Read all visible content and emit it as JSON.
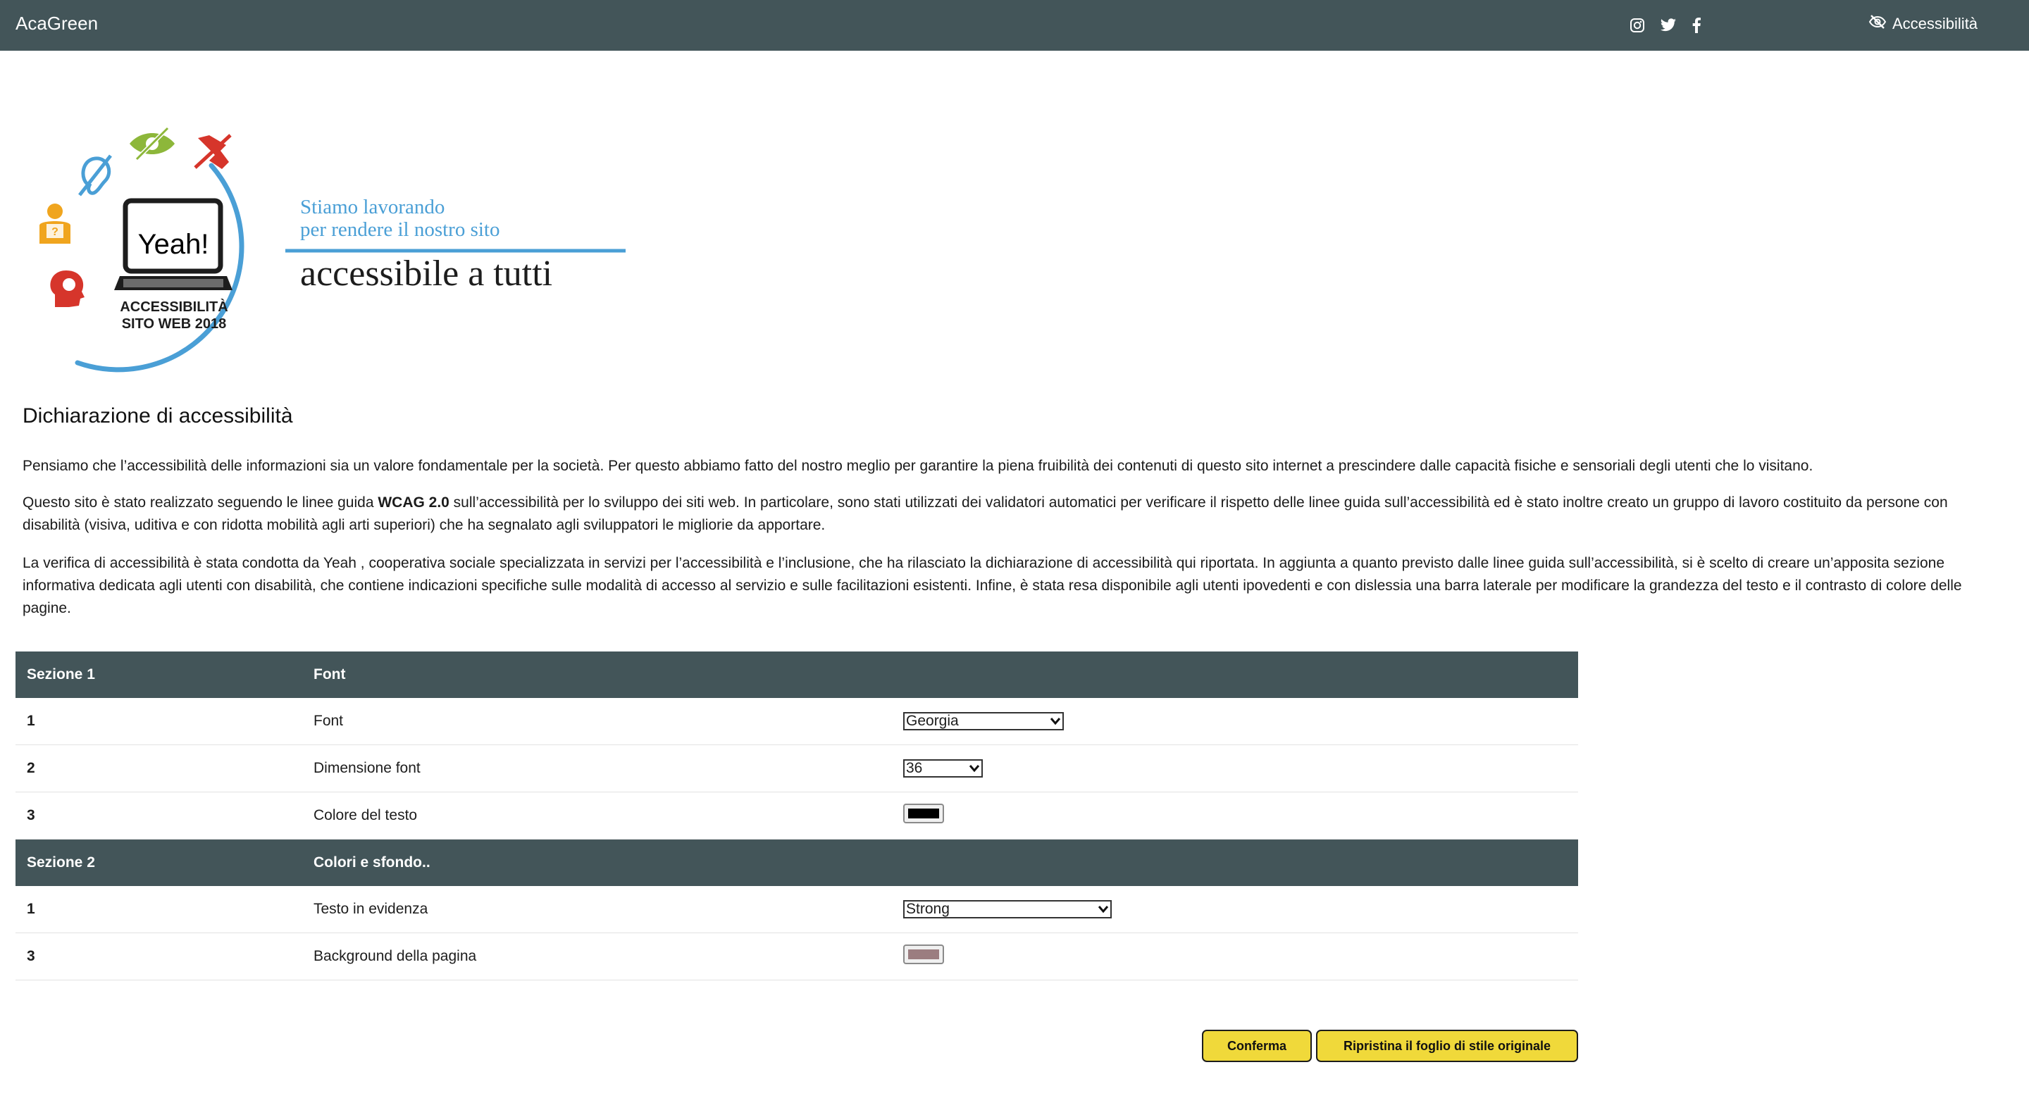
{
  "navbar": {
    "brand": "AcaGreen",
    "social": [
      "instagram-icon",
      "twitter-icon",
      "facebook-icon"
    ],
    "accessibility_label": "Accessibilità",
    "bg_color": "#435559"
  },
  "banner": {
    "tagline_line1": "Stiamo lavorando",
    "tagline_line2": "per rendere il nostro sito",
    "headline": "accessibile a tutti",
    "laptop_logo": "Yeah!",
    "badge_line1": "ACCESSIBILITÀ",
    "badge_line2": "SITO WEB 2018"
  },
  "content": {
    "title": "Dichiarazione di accessibilità",
    "p1": "Pensiamo che l’accessibilità delle informazioni sia un valore fondamentale per la società. Per questo abbiamo fatto del nostro meglio per garantire la piena fruibilità dei contenuti di questo sito internet a prescindere dalle capacità fisiche e sensoriali degli utenti che lo visitano.",
    "p2_before": "Questo sito è stato realizzato seguendo le linee guida ",
    "p2_bold": "WCAG 2.0",
    "p2_after": " sull’accessibilità per lo sviluppo dei siti web. In particolare, sono stati utilizzati dei validatori automatici per verificare il rispetto delle linee guida sull’accessibilità ed è stato inoltre creato un gruppo di lavoro costituito da persone con disabilità (visiva, uditiva e con ridotta mobilità agli arti superiori) che ha segnalato agli sviluppatori le migliorie da apportare.",
    "p3": "La verifica di accessibilità è stata condotta da Yeah , cooperativa sociale specializzata in servizi per l’accessibilità e l’inclusione, che ha rilasciato la dichiarazione di accessibilità qui riportata. In aggiunta a quanto previsto dalle linee guida sull’accessibilità, si è scelto di creare un’apposita sezione informativa dedicata agli utenti con disabilità, che contiene indicazioni specifiche sulle modalità di accesso al servizio e sulle facilitazioni esistenti. Infine, è stata resa disponibile agli utenti ipovedenti e con dislessia una barra laterale per modificare la grandezza del testo e il contrasto di colore delle pagine."
  },
  "settings": {
    "section1": {
      "label": "Sezione 1",
      "title": "Font"
    },
    "row_font": {
      "num": "1",
      "label": "Font",
      "value": "Georgia"
    },
    "row_size": {
      "num": "2",
      "label": "Dimensione font",
      "value": "36"
    },
    "row_color": {
      "num": "3",
      "label": "Colore del testo",
      "color": "#000000"
    },
    "section2": {
      "label": "Sezione 2",
      "title": "Colori e sfondo.."
    },
    "row_emph": {
      "num": "1",
      "label": "Testo in evidenza",
      "value": "Strong"
    },
    "row_bg": {
      "num": "3",
      "label": "Background della pagina",
      "color": "#9b7d80"
    }
  },
  "buttons": {
    "confirm": "Conferma",
    "reset": "Ripristina il foglio di stile originale",
    "color": "#f0d93a"
  }
}
